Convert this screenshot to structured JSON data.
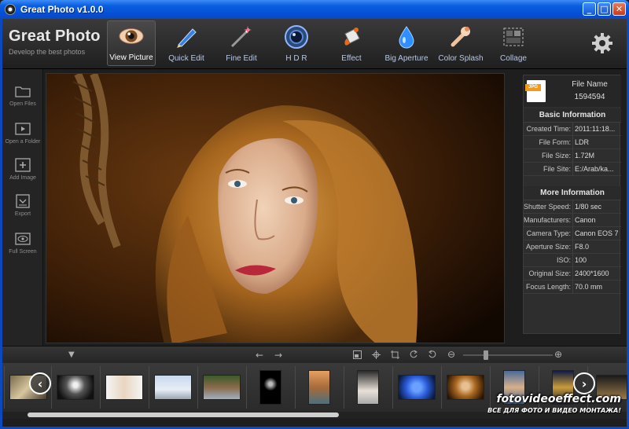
{
  "window": {
    "title": "Great Photo v1.0.0",
    "minimize": "_",
    "maximize": "□",
    "close": "✕"
  },
  "brand": {
    "name": "Great Photo",
    "tagline": "Develop the best photos"
  },
  "toolbar": {
    "tools": [
      {
        "label": "View Picture",
        "icon": "eye-icon",
        "active": true
      },
      {
        "label": "Quick Edit",
        "icon": "pencil-icon"
      },
      {
        "label": "Fine Edit",
        "icon": "magic-wand-icon"
      },
      {
        "label": "H D R",
        "icon": "lens-icon"
      },
      {
        "label": "Effect",
        "icon": "paint-bucket-icon"
      },
      {
        "label": "Big Aperture",
        "icon": "water-drop-icon"
      },
      {
        "label": "Color Splash",
        "icon": "color-splash-icon"
      },
      {
        "label": "Collage",
        "icon": "collage-icon"
      }
    ],
    "settings_icon": "gear-icon"
  },
  "sidebar": {
    "items": [
      {
        "label": "Open Files",
        "icon": "folder-icon"
      },
      {
        "label": "Open a Folder",
        "icon": "folder-play-icon"
      },
      {
        "label": "Add Image",
        "icon": "add-image-icon"
      },
      {
        "label": "Export",
        "icon": "export-icon"
      },
      {
        "label": "Full Screen",
        "icon": "fullscreen-eye-icon"
      }
    ]
  },
  "info_panel": {
    "file_name_label": "File Name",
    "file_name": "1594594",
    "file_type_badge": "JPG",
    "basic_title": "Basic Information",
    "basic": [
      {
        "key": "Created Time:",
        "value": "2011:11:18..."
      },
      {
        "key": "File Form:",
        "value": "LDR"
      },
      {
        "key": "File Size:",
        "value": "1.72M"
      },
      {
        "key": "File Site:",
        "value": "E:/Arab/ka..."
      }
    ],
    "more_title": "More Information",
    "more": [
      {
        "key": "Shutter Speed:",
        "value": "1/80 sec"
      },
      {
        "key": "Manufacturers:",
        "value": "Canon"
      },
      {
        "key": "Camera Type:",
        "value": "Canon EOS 7I"
      },
      {
        "key": "Aperture Size:",
        "value": "F8.0"
      },
      {
        "key": "ISO:",
        "value": "100"
      },
      {
        "key": "Original Size:",
        "value": "2400*1600"
      },
      {
        "key": "Focus Length:",
        "value": "70.0 mm"
      }
    ]
  },
  "controls": {
    "collapse": "▼",
    "prev": "←",
    "next": "→",
    "zoom_out": "⊖",
    "zoom_in": "⊕",
    "zoom_level": 0.25
  },
  "filmstrip": {
    "prev": "‹",
    "next": "›"
  },
  "watermark": {
    "site": "fotovideoeffect.com",
    "slogan": "ВСЕ ДЛЯ ФОТО И ВИДЕО МОНТАЖА!"
  }
}
